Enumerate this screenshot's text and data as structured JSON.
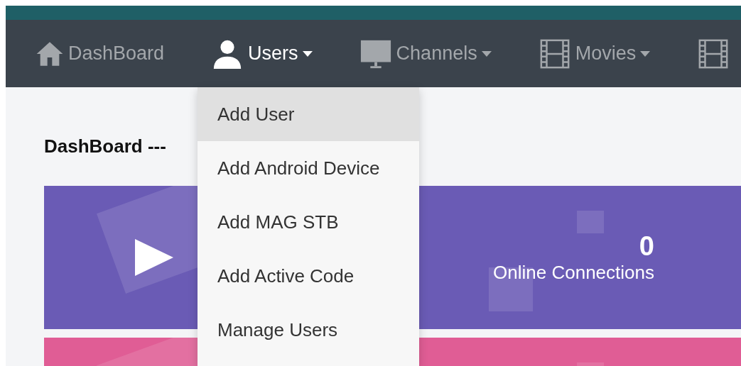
{
  "nav": {
    "items": [
      {
        "kind": "home",
        "label": "DashBoard",
        "dropdown": false,
        "selected": false
      },
      {
        "kind": "user",
        "label": "Users",
        "dropdown": true,
        "selected": true
      },
      {
        "kind": "monitor",
        "label": "Channels",
        "dropdown": true,
        "selected": false
      },
      {
        "kind": "film",
        "label": "Movies",
        "dropdown": true,
        "selected": false
      },
      {
        "kind": "film",
        "dropdown": false,
        "selected": false
      }
    ]
  },
  "dropdown_menu": {
    "items": [
      {
        "label": "Add User",
        "selected": true
      },
      {
        "label": "Add Android Device",
        "selected": false
      },
      {
        "label": "Add MAG STB",
        "selected": false
      },
      {
        "label": "Add Active Code",
        "selected": false
      },
      {
        "label": "Manage Users",
        "selected": false
      }
    ]
  },
  "heading": "DashBoard ---",
  "cards": [
    {
      "kind": "play",
      "color": "#6a5bb5",
      "value": "0",
      "label": "Online Connections"
    },
    {
      "kind": "blank",
      "color": "#e05d95"
    }
  ]
}
